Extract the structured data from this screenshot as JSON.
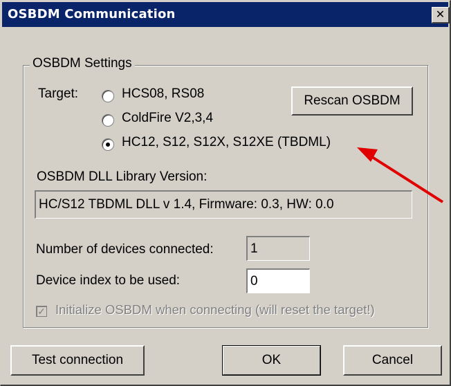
{
  "window": {
    "title": "OSBDM Communication",
    "close_icon": "✕"
  },
  "settings_group": {
    "label": "OSBDM Settings"
  },
  "target": {
    "label": "Target:",
    "options": [
      {
        "label": "HCS08, RS08",
        "checked": false
      },
      {
        "label": "ColdFire V2,3,4",
        "checked": false
      },
      {
        "label": "HC12, S12, S12X, S12XE (TBDML)",
        "checked": true
      }
    ]
  },
  "rescan_button": "Rescan OSBDM",
  "dll_version": {
    "label": "OSBDM DLL Library Version:",
    "value": "HC/S12 TBDML DLL v 1.4, Firmware: 0.3, HW: 0.0"
  },
  "devices_connected": {
    "label": "Number of devices connected:",
    "value": "1"
  },
  "device_index": {
    "label": "Device index to be used:",
    "value": "0"
  },
  "initialize_checkbox": {
    "label": "Initialize OSBDM when connecting (will reset the target!)",
    "checked": true,
    "disabled": true
  },
  "buttons": {
    "test": "Test connection",
    "ok": "OK",
    "cancel": "Cancel"
  },
  "annotation": {
    "arrow_color": "#e00000"
  }
}
